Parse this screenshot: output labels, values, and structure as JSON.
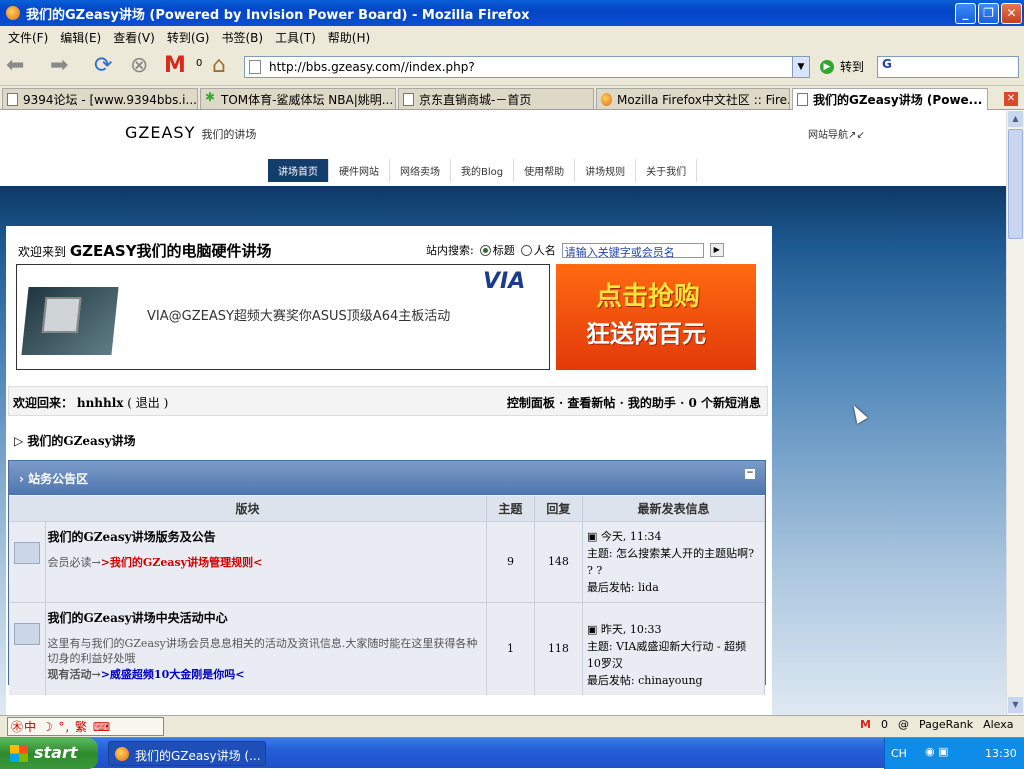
{
  "window": {
    "title": "我们的GZeasy讲场 (Powered by Invision Power Board) - Mozilla Firefox"
  },
  "menu": [
    "文件(F)",
    "编辑(E)",
    "查看(V)",
    "转到(G)",
    "书签(B)",
    "工具(T)",
    "帮助(H)"
  ],
  "toolbar": {
    "mail_count": "0",
    "url": "http://bbs.gzeasy.com//index.php?",
    "go_label": "转到",
    "search_logo": "G"
  },
  "tabs": [
    "9394论坛 - [www.9394bbs.i...",
    "TOM体育-鲨威体坛 NBA|姚明...",
    "京东直销商城-－首页",
    "Mozilla Firefox中文社区 :: Fire...",
    "我们的GZeasy讲场 (Powe..."
  ],
  "site": {
    "logo": "GZEASY",
    "logo_sub": "我们的讲场",
    "site_nav": "网站导航↗↙",
    "nav": [
      "讲场首页",
      "硬件网站",
      "网络卖场",
      "我的Blog",
      "使用帮助",
      "讲场规则",
      "关于我们"
    ]
  },
  "page": {
    "welcome_prefix": "欢迎来到",
    "welcome_title": "GZEASY我们的电脑硬件讲场",
    "search_label": "站内搜索:",
    "radio_title": "标题",
    "radio_name": "人名",
    "search_placeholder": "请输入关键字或会员名",
    "banner_text": "VIA@GZEASY超频大赛奖你ASUS顶级A64主板活动",
    "banner_logo": "VIA",
    "ad_line1": "点击抢购",
    "ad_line2": "狂送两百元"
  },
  "user": {
    "welcome": "欢迎回来：",
    "name": "hnhhlx",
    "logout": "( 退出 )",
    "links": "控制面板 · 查看新帖 · 我的助手 · 0 个新短消息"
  },
  "breadcrumb": "我们的GZeasy讲场",
  "category": {
    "title": "站务公告区",
    "headers": [
      "版块",
      "主题",
      "回复",
      "最新发表信息"
    ],
    "forums": [
      {
        "name": "我们的GZeasy讲场版务及公告",
        "desc_prefix": "会员必读→",
        "desc_link": ">我们的GZeasy讲场管理规则<",
        "topics": "9",
        "replies": "148",
        "time": "今天, 11:34",
        "subject": "主题: 怎么搜索某人开的主题贴啊? ? ?",
        "poster": "最后发帖: lida"
      },
      {
        "name": "我们的GZeasy讲场中央活动中心",
        "desc": "这里有与我们的GZeasy讲场会员息息相关的活动及资讯信息.大家随时能在这里获得各种切身的利益好处哦",
        "desc_prefix": "现有活动→",
        "desc_link": ">威盛超频10大金刚是你吗<",
        "topics": "1",
        "replies": "118",
        "time": "昨天, 10:33",
        "subject": "主题: VIA威盛迎新大行动 - 超频10罗汉",
        "poster": "最后发帖: chinayoung"
      }
    ]
  },
  "status": {
    "ime": "中 ☽ °, 繁",
    "mail": "0",
    "pagerank": "PageRank",
    "alexa": "Alexa"
  },
  "taskbar": {
    "start": "start",
    "item": "我们的GZeasy讲场 (...",
    "lang": "CH",
    "clock": "13:30"
  }
}
